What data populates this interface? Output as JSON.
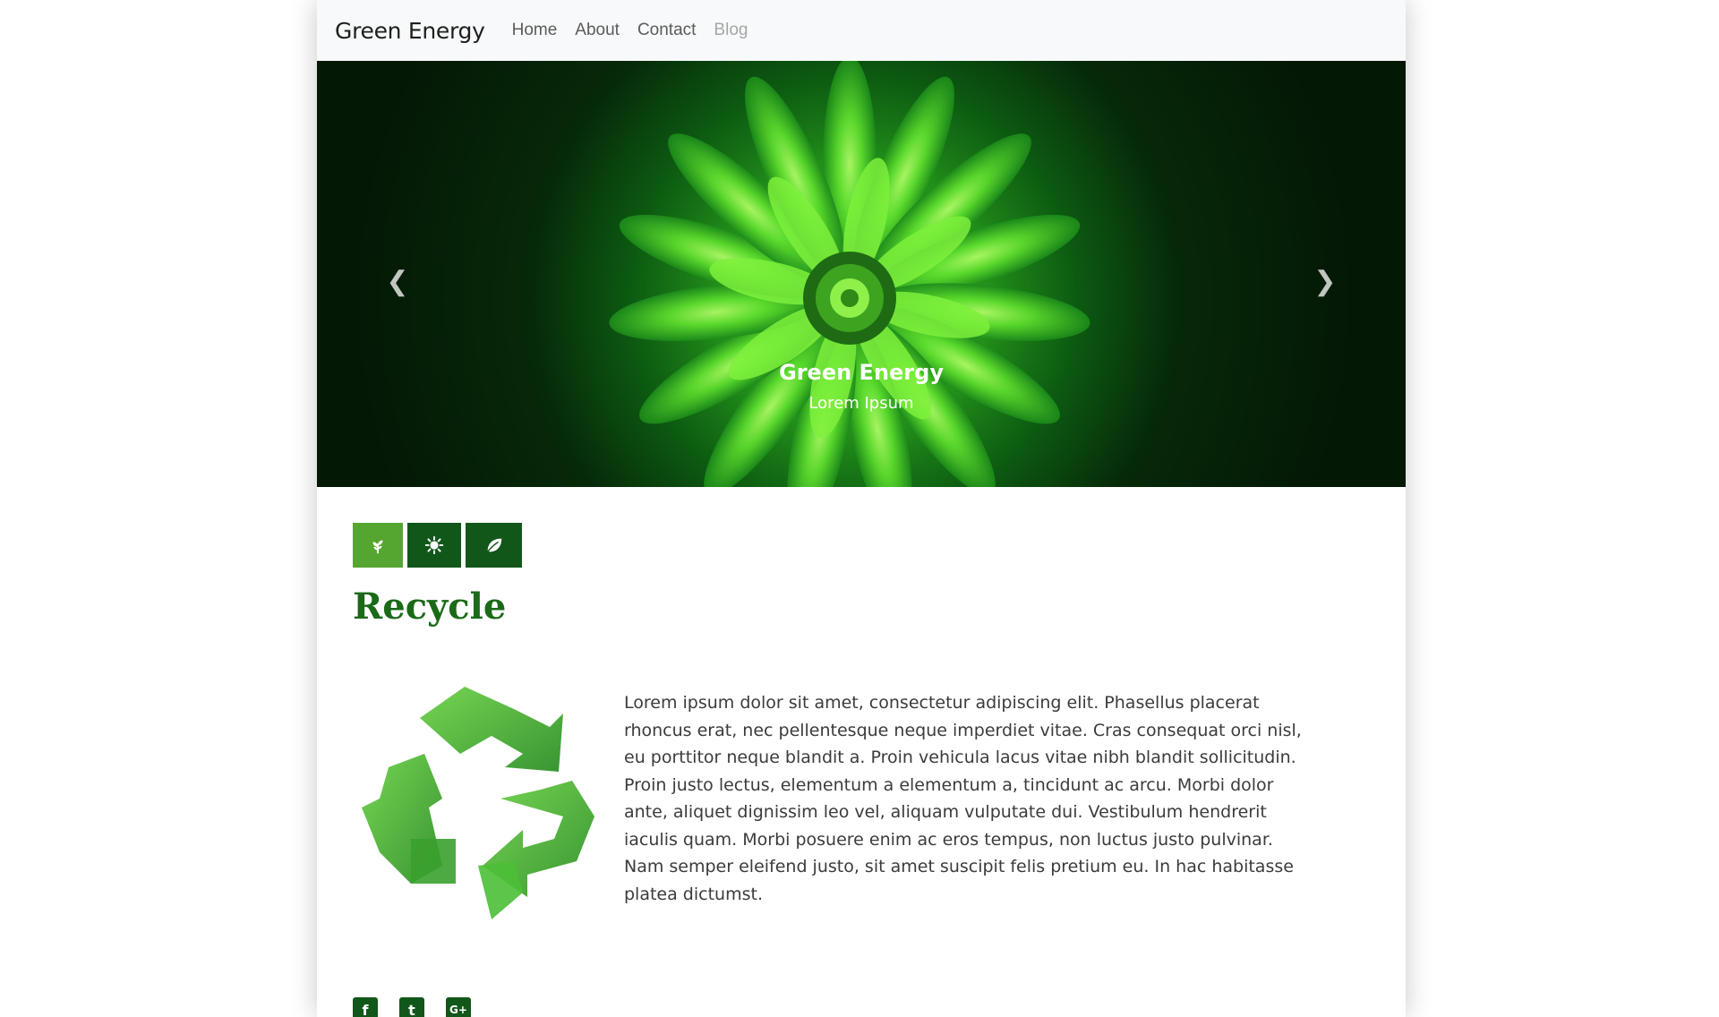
{
  "navbar": {
    "brand": "Green Energy",
    "links": [
      {
        "label": "Home"
      },
      {
        "label": "About"
      },
      {
        "label": "Contact"
      },
      {
        "label": "Blog",
        "disabled": true
      }
    ]
  },
  "hero": {
    "title": "Green Energy",
    "subtitle": "Lorem Ipsum",
    "prev_icon": "chevron-left-icon",
    "next_icon": "chevron-right-icon"
  },
  "icon_buttons": [
    {
      "icon": "plant-icon",
      "color": "#55a630",
      "active": true
    },
    {
      "icon": "sun-icon",
      "color": "#12571a"
    },
    {
      "icon": "leaf-icon",
      "color": "#12571a"
    }
  ],
  "section": {
    "title": "Recycle",
    "image": "recycle-symbol",
    "body": "Lorem ipsum dolor sit amet, consectetur adipiscing elit. Phasellus placerat rhoncus erat, nec pellentesque neque imperdiet vitae. Cras consequat orci nisl, eu porttitor neque blandit a. Proin vehicula lacus vitae nibh blandit sollicitudin. Proin justo lectus, elementum a elementum a, tincidunt ac arcu. Morbi dolor ante, aliquet dignissim leo vel, aliquam vulputate dui. Vestibulum hendrerit iaculis quam. Morbi posuere enim ac eros tempus, non luctus justo pulvinar. Nam semper eleifend justo, sit amet suscipit felis pretium eu. In hac habitasse platea dictumst."
  },
  "social": [
    {
      "icon": "facebook-icon",
      "glyph": "f"
    },
    {
      "icon": "twitter-icon",
      "glyph": "t"
    },
    {
      "icon": "google-plus-icon",
      "glyph": "G+"
    }
  ],
  "colors": {
    "accent_light": "#55a630",
    "accent_dark": "#12571a",
    "title_green": "#1a6a17",
    "navbar_bg": "#f8f9fa"
  }
}
